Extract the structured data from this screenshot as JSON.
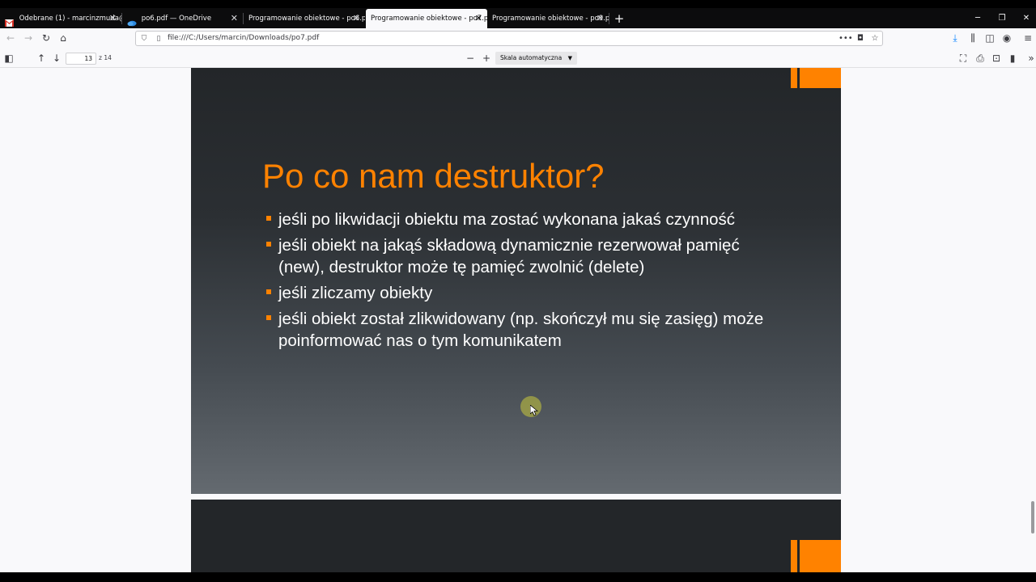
{
  "browser": {
    "tabs": [
      {
        "label": "Odebrane (1) - marcinzmuda@",
        "icon": "gmail-icon",
        "active": false
      },
      {
        "label": "po6.pdf — OneDrive",
        "icon": "onedrive-icon",
        "active": false
      },
      {
        "label": "Programowanie obiektowe - po6.p",
        "icon": "pdf-icon",
        "active": false
      },
      {
        "label": "Programowanie obiektowe - po7.p",
        "icon": "pdf-icon",
        "active": true
      },
      {
        "label": "Programowanie obiektowe - po9.p",
        "icon": "pdf-icon",
        "active": false
      }
    ],
    "new_tab_icon": "plus-icon",
    "window_controls": [
      "minimize-icon",
      "restore-icon",
      "close-icon"
    ],
    "url": "file:///C:/Users/marcin/Downloads/po7.pdf"
  },
  "pdf_toolbar": {
    "current_page": "13",
    "page_count": "z 14",
    "zoom": "Skala automatyczna"
  },
  "slide": {
    "title": "Po co nam destruktor?",
    "bullets": [
      "jeśli po likwidacji obiektu ma zostać wykonana jakaś czynność",
      "jeśli obiekt na jakąś składową dynamicznie rezerwował pamięć (new), destruktor może tę pamięć zwolnić (delete)",
      "jeśli zliczamy obiekty",
      "jeśli obiekt został zlikwidowany (np. skończył mu się zasięg) może poinformować nas o tym komunikatem"
    ]
  },
  "colors": {
    "accent": "#ff8200",
    "slide_dark": "#232629",
    "slide_light": "#646a70",
    "tabstrip": "#0c0c0d"
  }
}
